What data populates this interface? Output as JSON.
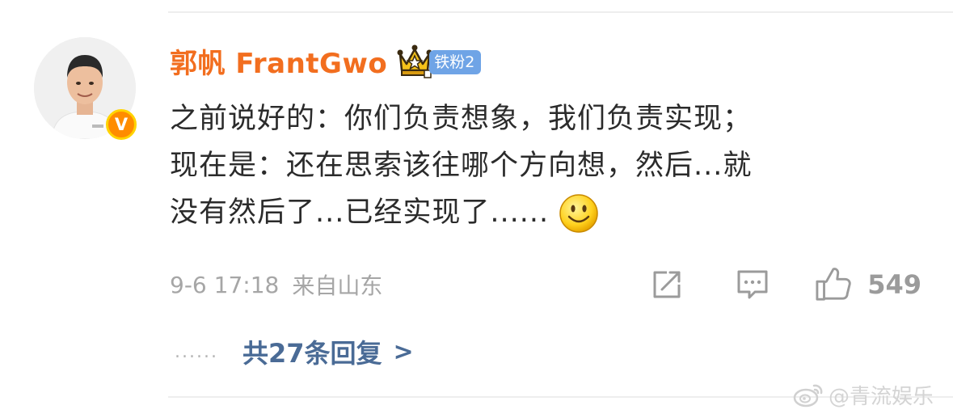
{
  "comment": {
    "author": "郭帆 FrantGwo",
    "verified_badge": "V",
    "fan_badge": "铁粉2",
    "text_lines": [
      "之前说好的：你们负责想象，我们负责实现；",
      "现在是：还在思索该往哪个方向想，然后...就",
      "没有然后了...已经实现了......"
    ],
    "emoji": "smile-emoji",
    "timestamp": "9-6 17:18",
    "location": "来自山东",
    "like_count": "549",
    "replies_dots": "......",
    "replies_label": "共27条回复",
    "replies_arrow": ">"
  },
  "icons": {
    "avatar": "avatar",
    "crown": "crown-icon",
    "share": "share-icon",
    "reply": "comment-icon",
    "like": "thumbs-up-icon",
    "watermark_logo": "weibo-logo"
  },
  "watermark": {
    "text": "@青流娱乐"
  },
  "colors": {
    "author": "#f26e1f",
    "fan_badge": "#6fa4e6",
    "meta": "#a6a6a6",
    "reply_link": "#4a6b96",
    "verified": "#ff8c00"
  }
}
